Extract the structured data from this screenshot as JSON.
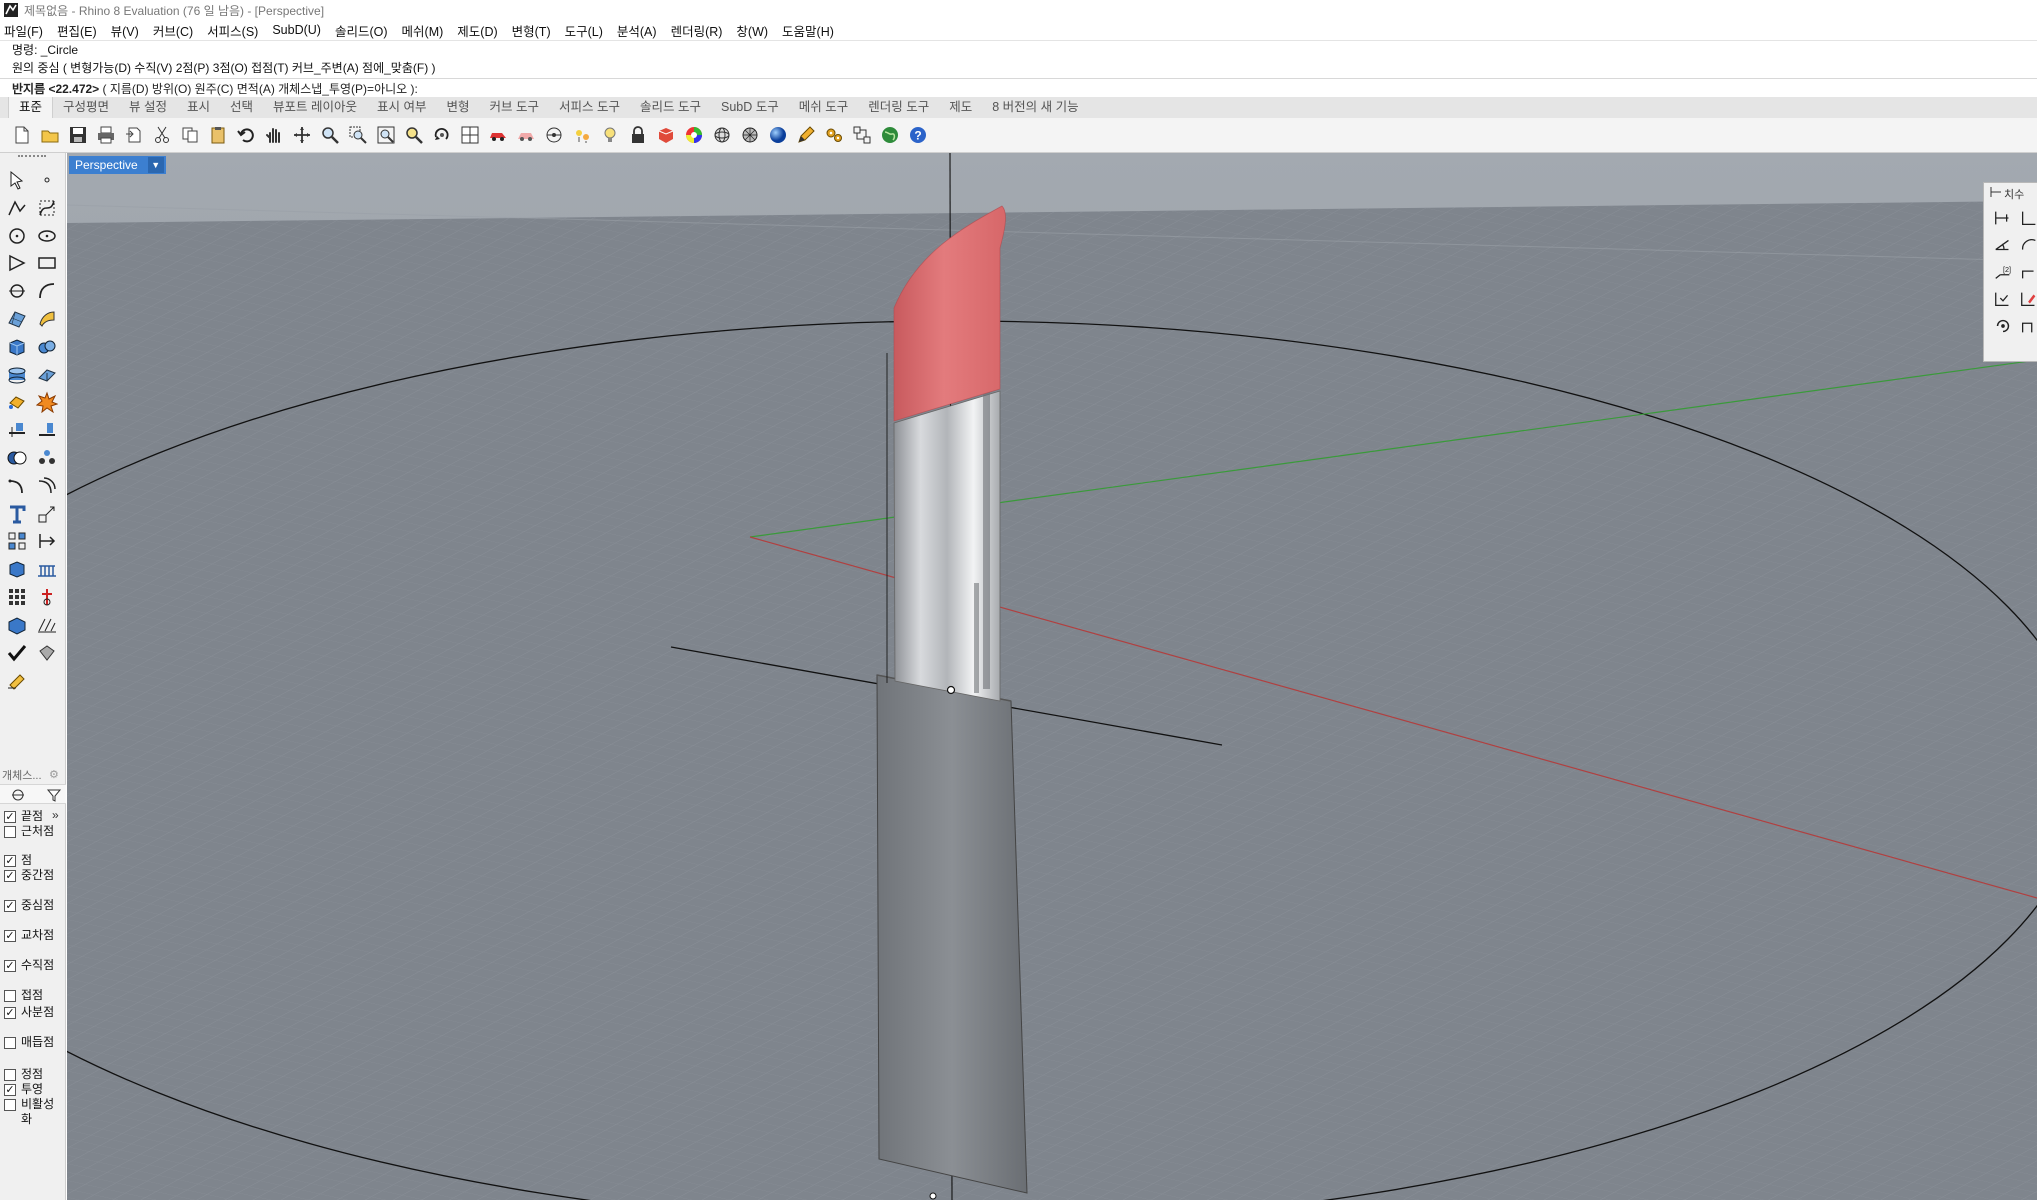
{
  "window": {
    "title": "제목없음 - Rhino 8 Evaluation (76 일 남음) - [Perspective]"
  },
  "menubar": {
    "items": [
      "파일(F)",
      "편집(E)",
      "뷰(V)",
      "커브(C)",
      "서피스(S)",
      "SubD(U)",
      "솔리드(O)",
      "메쉬(M)",
      "제도(D)",
      "변형(T)",
      "도구(L)",
      "분석(A)",
      "렌더링(R)",
      "창(W)",
      "도움말(H)"
    ]
  },
  "command": {
    "history_1": "명령: _Circle",
    "history_2": "원의 중심 ( 변형가능(D)  수직(V)  2점(P)  3점(O)  접점(T)  커브_주변(A)  점에_맞춤(F) )",
    "prompt_label": "반지름 <22.472>",
    "prompt_options": " ( 지름(D)  방위(O)  원주(C)  면적(A)  개체스냅_투영(P)=아니오 ):"
  },
  "tabs": {
    "items": [
      "표준",
      "구성평면",
      "뷰 설정",
      "표시",
      "선택",
      "뷰포트 레이아웃",
      "표시 여부",
      "변형",
      "커브 도구",
      "서피스 도구",
      "솔리드 도구",
      "SubD 도구",
      "메쉬 도구",
      "렌더링 도구",
      "제도",
      "8 버전의 새 기능"
    ],
    "active_index": 0
  },
  "toolbar": {
    "icons": [
      "new-file-icon",
      "open-file-icon",
      "save-icon",
      "print-icon",
      "import-icon",
      "cut-icon",
      "copy-icon",
      "paste-icon",
      "undo-icon",
      "pan-hand-icon",
      "rotate-view-icon",
      "zoom-icon",
      "zoom-window-icon",
      "zoom-extents-icon",
      "zoom-selected-icon",
      "view-rotate-icon",
      "four-viewports-icon",
      "car-icon",
      "render-preview-icon",
      "snap-target-icon",
      "lights-icon",
      "bulb-icon",
      "lock-icon",
      "material-icon",
      "color-wheel-icon",
      "sphere-wire-icon",
      "sphere-grid-icon",
      "render-sphere-icon",
      "pencil-icon",
      "gear-cluster-icon",
      "grasshopper-icon",
      "globe-icon",
      "help-icon"
    ]
  },
  "left_tools": {
    "icons": [
      "select-arrow-icon",
      "point-icon",
      "polyline-icon",
      "curve-icon",
      "circle-icon",
      "ellipse-icon",
      "polygon-icon",
      "rectangle-icon",
      "arc-icon",
      "curve-tool-icon",
      "surface-icon",
      "sweep-icon",
      "box-icon",
      "sphere-icon",
      "cylinder-icon",
      "extrude-icon",
      "mesh-icon",
      "explode-icon",
      "trim-icon",
      "split-icon",
      "boolean-icon",
      "join-icon",
      "fillet-icon",
      "offset-icon",
      "text-icon",
      "scale-icon",
      "array-icon",
      "dimension-icon",
      "block-icon",
      "hatch-icon",
      "grid-array-icon",
      "gumball-icon",
      "layer-icon",
      "history-icon",
      "check-icon",
      "cube-wire-icon",
      "paint-icon"
    ]
  },
  "osnap_panel": {
    "title": "개체스...",
    "items": [
      {
        "label": "끝점",
        "checked": true
      },
      {
        "label": "근처점",
        "checked": false
      },
      {
        "label": "점",
        "checked": true
      },
      {
        "label": "중간점",
        "checked": true
      },
      {
        "label": "중심점",
        "checked": true
      },
      {
        "label": "교차점",
        "checked": true
      },
      {
        "label": "수직점",
        "checked": true
      },
      {
        "label": "접점",
        "checked": false
      },
      {
        "label": "사분점",
        "checked": true
      },
      {
        "label": "매듭점",
        "checked": false
      },
      {
        "label": "정점",
        "checked": false
      },
      {
        "label": "투영",
        "checked": true
      },
      {
        "label": "비활성화",
        "checked": false
      }
    ]
  },
  "viewport": {
    "label": "Perspective",
    "background": "#7f858d",
    "lipstick_color": "#d86a6a",
    "x_axis_color": "#b04040",
    "y_axis_color": "#3a9a3a"
  },
  "float_panel": {
    "title": "치수",
    "icons": [
      "dim-linear-icon",
      "dim-aligned-icon",
      "dim-angle-icon",
      "dim-radius-icon",
      "dim-number-icon",
      "dim-leader-icon",
      "dim-text-icon",
      "dim-edit-icon",
      "dim-rotate-icon",
      "dim-style-icon"
    ]
  }
}
